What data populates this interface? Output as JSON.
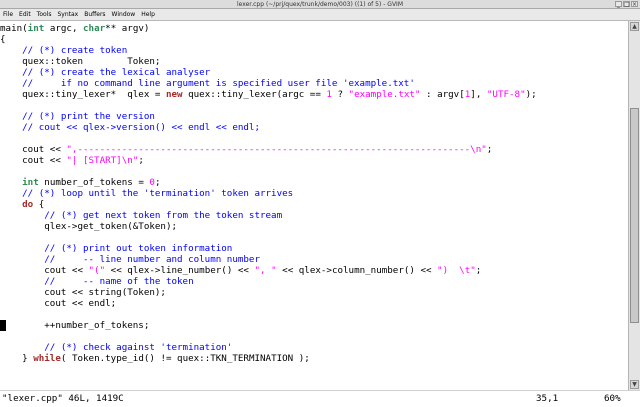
{
  "window": {
    "title": "lexer.cpp (~/prj/quex/trunk/demo/003) ((1) of 5) - GVIM",
    "buttons": [
      "_",
      "□",
      "×"
    ]
  },
  "menubar": {
    "items": [
      "File",
      "Edit",
      "Tools",
      "Syntax",
      "Buffers",
      "Window",
      "Help"
    ]
  },
  "editor": {
    "cursor_line": 27,
    "lines": [
      [
        {
          "t": "main(",
          "c": "plain"
        },
        {
          "t": "int",
          "c": "type"
        },
        {
          "t": " argc, ",
          "c": "plain"
        },
        {
          "t": "char",
          "c": "type"
        },
        {
          "t": "** argv)",
          "c": "plain"
        }
      ],
      [
        {
          "t": "{",
          "c": "plain"
        }
      ],
      [
        {
          "t": "    // (*) create token",
          "c": "comment"
        }
      ],
      [
        {
          "t": "    quex::token        Token;",
          "c": "plain"
        }
      ],
      [
        {
          "t": "    // (*) create the lexical analyser",
          "c": "comment"
        }
      ],
      [
        {
          "t": "    //     if no command line argument is specified user file 'example.txt'",
          "c": "comment"
        }
      ],
      [
        {
          "t": "    quex::tiny_lexer*  qlex = ",
          "c": "plain"
        },
        {
          "t": "new",
          "c": "kw"
        },
        {
          "t": " quex::tiny_lexer(argc == ",
          "c": "plain"
        },
        {
          "t": "1",
          "c": "num"
        },
        {
          "t": " ? ",
          "c": "plain"
        },
        {
          "t": "\"example.txt\"",
          "c": "str"
        },
        {
          "t": " : argv[",
          "c": "plain"
        },
        {
          "t": "1",
          "c": "num"
        },
        {
          "t": "], ",
          "c": "plain"
        },
        {
          "t": "\"UTF-8\"",
          "c": "str"
        },
        {
          "t": ");",
          "c": "plain"
        }
      ],
      [],
      [
        {
          "t": "    // (*) print the version",
          "c": "comment"
        }
      ],
      [
        {
          "t": "    // cout << qlex->version() << endl << endl;",
          "c": "comment"
        }
      ],
      [],
      [
        {
          "t": "    cout << ",
          "c": "plain"
        },
        {
          "t": "\",-----------------------------------------------------------------------\\n\"",
          "c": "str"
        },
        {
          "t": ";",
          "c": "plain"
        }
      ],
      [
        {
          "t": "    cout << ",
          "c": "plain"
        },
        {
          "t": "\"| [START]\\n\"",
          "c": "str"
        },
        {
          "t": ";",
          "c": "plain"
        }
      ],
      [],
      [
        {
          "t": "    ",
          "c": "plain"
        },
        {
          "t": "int",
          "c": "type"
        },
        {
          "t": " number_of_tokens = ",
          "c": "plain"
        },
        {
          "t": "0",
          "c": "num"
        },
        {
          "t": ";",
          "c": "plain"
        }
      ],
      [
        {
          "t": "    // (*) loop until the 'termination' token arrives",
          "c": "comment"
        }
      ],
      [
        {
          "t": "    ",
          "c": "plain"
        },
        {
          "t": "do",
          "c": "kw"
        },
        {
          "t": " {",
          "c": "plain"
        }
      ],
      [
        {
          "t": "        // (*) get next token from the token stream",
          "c": "comment"
        }
      ],
      [
        {
          "t": "        qlex->get_token(&Token);",
          "c": "plain"
        }
      ],
      [],
      [
        {
          "t": "        // (*) print out token information",
          "c": "comment"
        }
      ],
      [
        {
          "t": "        //     -- line number and column number",
          "c": "comment"
        }
      ],
      [
        {
          "t": "        cout << ",
          "c": "plain"
        },
        {
          "t": "\"(\"",
          "c": "str"
        },
        {
          "t": " << qlex->line_number() << ",
          "c": "plain"
        },
        {
          "t": "\", \"",
          "c": "str"
        },
        {
          "t": " << qlex->column_number() << ",
          "c": "plain"
        },
        {
          "t": "\")  \\t\"",
          "c": "str"
        },
        {
          "t": ";",
          "c": "plain"
        }
      ],
      [
        {
          "t": "        //     -- name of the token",
          "c": "comment"
        }
      ],
      [
        {
          "t": "        cout << string(Token);",
          "c": "plain"
        }
      ],
      [
        {
          "t": "        cout << endl;",
          "c": "plain"
        }
      ],
      [],
      [
        {
          "t": "        ++number_of_tokens;",
          "c": "plain"
        }
      ],
      [],
      [
        {
          "t": "        // (*) check against 'termination'",
          "c": "comment"
        }
      ],
      [
        {
          "t": "    } ",
          "c": "plain"
        },
        {
          "t": "while",
          "c": "kw"
        },
        {
          "t": "( Token.type_id() != quex::TKN_TERMINATION );",
          "c": "plain"
        }
      ]
    ]
  },
  "status": {
    "file": "\"lexer.cpp\" 46L, 1419C",
    "position": "35,1",
    "percent": "60%"
  },
  "scrollbar": {
    "up_arrow": "▲",
    "down_arrow": "▼",
    "thumb_start": 0.22,
    "thumb_size": 0.62
  },
  "colors": {
    "comment": "#0000ff",
    "keyword": "#a52a2a",
    "type": "#2e8b57",
    "string": "#ff00ff"
  }
}
